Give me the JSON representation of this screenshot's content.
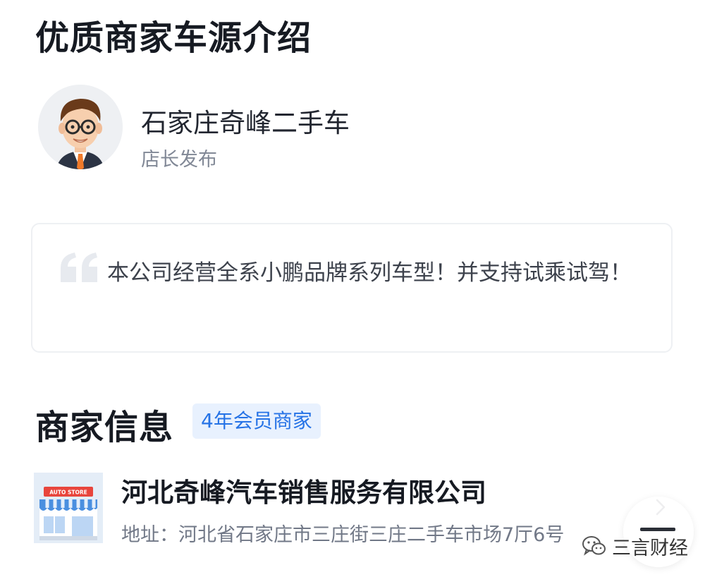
{
  "intro": {
    "title": "优质商家车源介绍",
    "dealer_name": "石家庄奇峰二手车",
    "dealer_role": "店长发布",
    "quote": "本公司经营全系小鹏品牌系列车型！并支持试乘试驾！"
  },
  "merchant": {
    "title": "商家信息",
    "badge": "4年会员商家",
    "company_name": "河北奇峰汽车销售服务有限公司",
    "address": "地址：河北省石家庄市三庄街三庄二手车市场7厅6号",
    "store_sign": "AUTO STORE"
  },
  "watermark": {
    "text": "三言财经"
  },
  "icons": {
    "avatar": "cartoon-man-avatar",
    "quote": "quote-mark-icon",
    "store": "storefront-icon",
    "chevron": "chevron-right-icon",
    "menu": "menu-bar-icon",
    "wechat": "wechat-icon"
  },
  "colors": {
    "badge_bg": "#e8f1fe",
    "badge_text": "#2673e6",
    "title": "#161a22",
    "muted": "#818896"
  }
}
